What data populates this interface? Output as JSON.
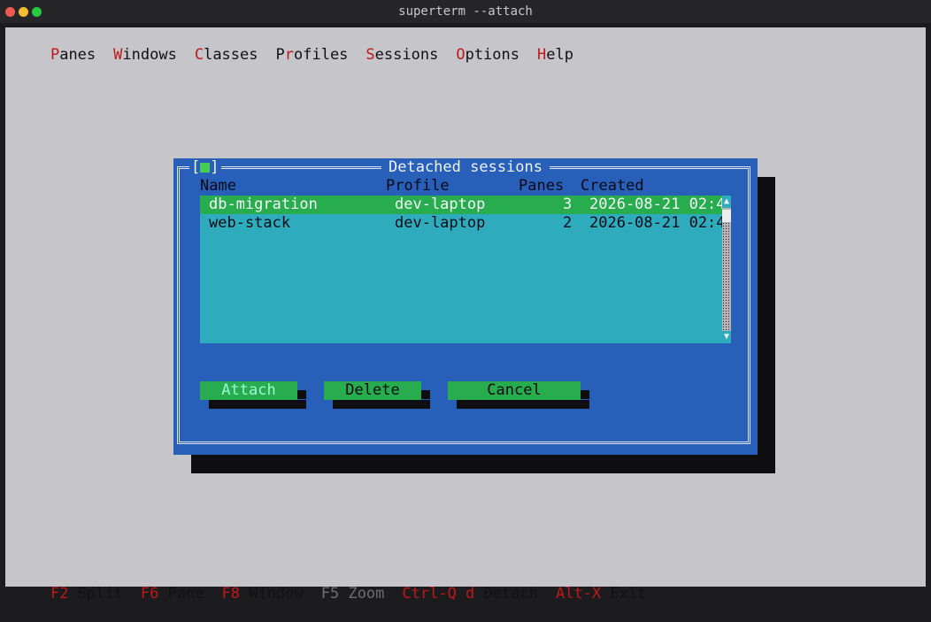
{
  "window": {
    "title": "superterm --attach"
  },
  "menu": [
    {
      "hot": "P",
      "rest": "anes"
    },
    {
      "hot": "W",
      "rest": "indows"
    },
    {
      "hot": "C",
      "rest": "lasses"
    },
    {
      "pre": "P",
      "hot": "r",
      "rest": "ofiles"
    },
    {
      "hot": "S",
      "rest": "essions"
    },
    {
      "hot": "O",
      "rest": "ptions"
    },
    {
      "hot": "H",
      "rest": "elp"
    }
  ],
  "dialog": {
    "title": "Detached sessions",
    "close_box": "[",
    "close_box_end": "]",
    "columns": {
      "name": "Name",
      "profile": "Profile",
      "panes": "Panes",
      "created": "Created"
    },
    "sessions": [
      {
        "name": "db-migration",
        "profile": "dev-laptop",
        "panes": "3",
        "created": "2026-08-21 02:4"
      },
      {
        "name": "web-stack",
        "profile": "dev-laptop",
        "panes": "2",
        "created": "2026-08-21 02:4"
      }
    ],
    "scroll_up": "▲",
    "scroll_down": "▼",
    "buttons": {
      "attach": "Attach",
      "delete": "Delete",
      "cancel": "Cancel"
    }
  },
  "status": [
    {
      "key": "F2",
      "label": "Split",
      "enabled": true
    },
    {
      "key": "F6",
      "label": "Pane",
      "enabled": true
    },
    {
      "key": "F8",
      "label": "Window",
      "enabled": true
    },
    {
      "key": "F5",
      "label": "Zoom",
      "enabled": false
    },
    {
      "key": "Ctrl-Q d",
      "label": "Detach",
      "enabled": true
    },
    {
      "key": "Alt-X",
      "label": "Exit",
      "enabled": true
    }
  ],
  "colors": {
    "dialog": "#285fb8",
    "list": "#2eacbe",
    "selection": "#27ad4d",
    "hotkey": "#c01818"
  }
}
